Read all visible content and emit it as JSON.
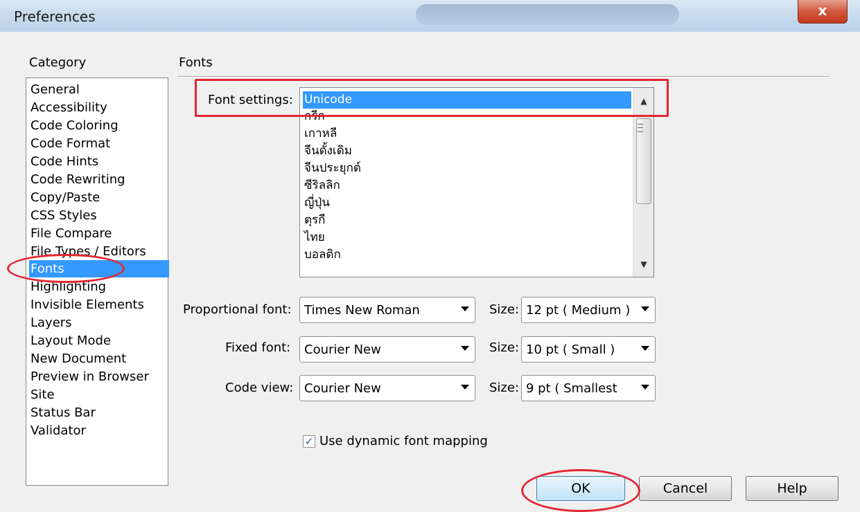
{
  "window": {
    "title": "Preferences",
    "close_label": "x"
  },
  "category": {
    "header": "Category",
    "items": [
      {
        "label": "General"
      },
      {
        "label": "Accessibility"
      },
      {
        "label": "Code Coloring"
      },
      {
        "label": "Code Format"
      },
      {
        "label": "Code Hints"
      },
      {
        "label": "Code Rewriting"
      },
      {
        "label": "Copy/Paste"
      },
      {
        "label": "CSS Styles"
      },
      {
        "label": "File Compare"
      },
      {
        "label": "File Types / Editors"
      },
      {
        "label": "Fonts"
      },
      {
        "label": "Highlighting"
      },
      {
        "label": "Invisible Elements"
      },
      {
        "label": "Layers"
      },
      {
        "label": "Layout Mode"
      },
      {
        "label": "New Document"
      },
      {
        "label": "Preview in Browser"
      },
      {
        "label": "Site"
      },
      {
        "label": "Status Bar"
      },
      {
        "label": "Validator"
      }
    ],
    "selected": "Fonts"
  },
  "section": {
    "title": "Fonts"
  },
  "font_settings": {
    "label": "Font settings:",
    "items": [
      "Unicode",
      "กรีก",
      "เกาหลี",
      "จีนดั้งเดิม",
      "จีนประยุกต์",
      "ซีริลลิก",
      "ญี่ปุ่น",
      "ตุรกี",
      "ไทย",
      "บอลติก"
    ],
    "selected": "Unicode"
  },
  "proportional": {
    "label": "Proportional font:",
    "value": "Times New Roman",
    "size_label": "Size:",
    "size_value": "12 pt  ( Medium )"
  },
  "fixed": {
    "label": "Fixed font:",
    "value": "Courier New",
    "size_label": "Size:",
    "size_value": "10 pt  ( Small )"
  },
  "code_view": {
    "label": "Code view:",
    "value": "Courier New",
    "size_label": "Size:",
    "size_value": "9 pt    ( Smallest"
  },
  "dynamic_mapping": {
    "label": "Use dynamic font mapping",
    "checked": true,
    "check_glyph": "✓"
  },
  "buttons": {
    "ok": "OK",
    "cancel": "Cancel",
    "help": "Help"
  },
  "colors": {
    "selection": "#3399ff",
    "annotation_red": "#e32632"
  }
}
